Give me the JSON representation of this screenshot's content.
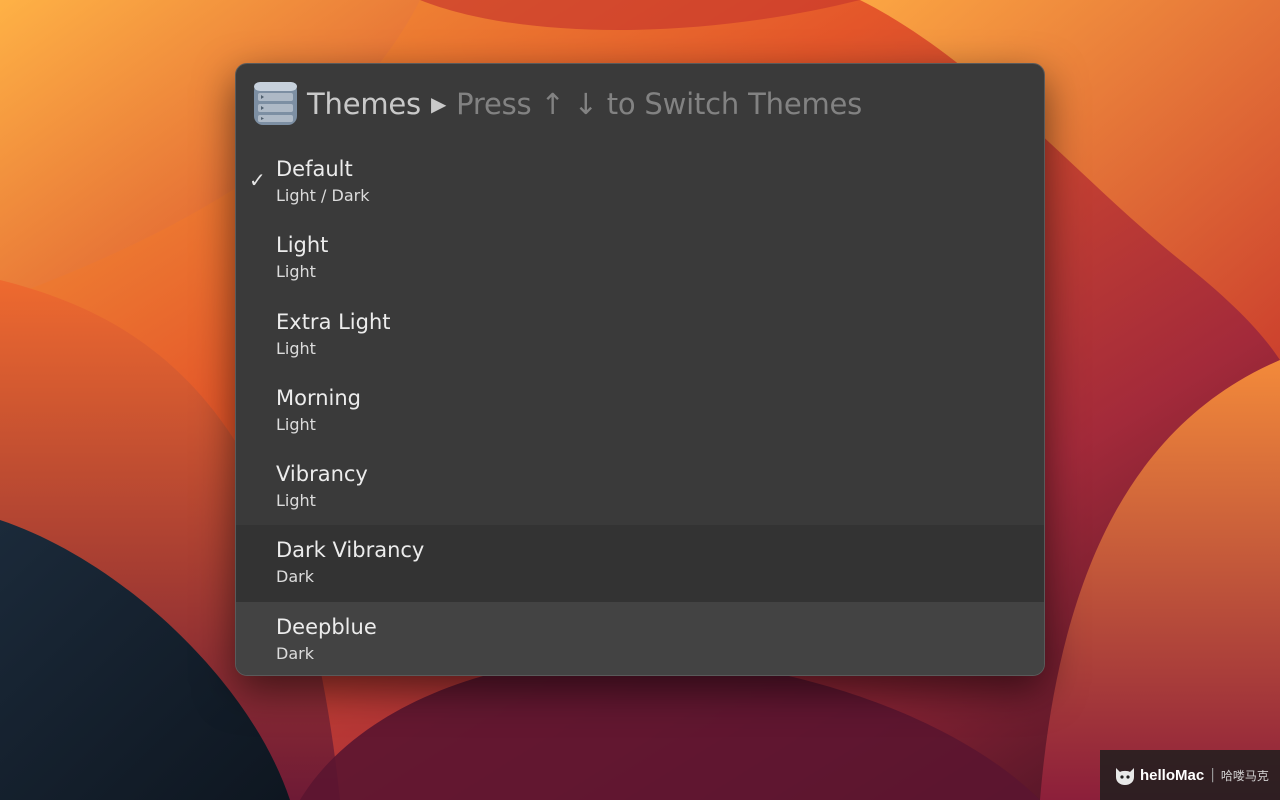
{
  "colors": {
    "window_bg": "#3a3a3a",
    "selected_row_bg": "#333333",
    "hover_row_bg": "#434343",
    "title_text": "#ececec",
    "hint_text": "#828282"
  },
  "query_bar": {
    "icon": "themes-list-icon",
    "keyword": "Themes",
    "arrow": "▶",
    "hint": "Press ↑ ↓ to Switch Themes"
  },
  "themes": [
    {
      "title": "Default",
      "subtitle": "Light / Dark",
      "checked": true,
      "state": "normal"
    },
    {
      "title": "Light",
      "subtitle": "Light",
      "checked": false,
      "state": "normal"
    },
    {
      "title": "Extra Light",
      "subtitle": "Light",
      "checked": false,
      "state": "normal"
    },
    {
      "title": "Morning",
      "subtitle": "Light",
      "checked": false,
      "state": "normal"
    },
    {
      "title": "Vibrancy",
      "subtitle": "Light",
      "checked": false,
      "state": "normal"
    },
    {
      "title": "Dark Vibrancy",
      "subtitle": "Dark",
      "checked": false,
      "state": "selected"
    },
    {
      "title": "Deepblue",
      "subtitle": "Dark",
      "checked": false,
      "state": "hover"
    }
  ],
  "checkmark": "✓",
  "watermark": {
    "brand": "helloMac",
    "separator": "|",
    "chinese": "哈喽马克"
  }
}
